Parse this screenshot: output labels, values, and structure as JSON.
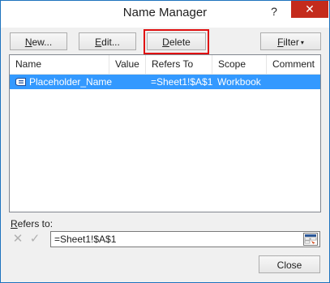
{
  "window": {
    "title": "Name Manager",
    "help": "?",
    "close_glyph": "✕"
  },
  "toolbar": {
    "new": {
      "mnemonic": "N",
      "rest": "ew..."
    },
    "edit": {
      "mnemonic": "E",
      "rest": "dit..."
    },
    "delete": {
      "mnemonic": "D",
      "rest": "elete"
    },
    "filter": {
      "mnemonic": "F",
      "rest": "ilter",
      "caret": "▾"
    }
  },
  "list": {
    "columns": [
      "Name",
      "Value",
      "Refers To",
      "Scope",
      "Comment"
    ],
    "rows": [
      {
        "name": "Placeholder_Name",
        "value": "",
        "refers_to": "=Sheet1!$A$1",
        "scope": "Workbook",
        "comment": "",
        "selected": true,
        "icon": "defined-name-icon"
      }
    ]
  },
  "refers": {
    "label_mnemonic": "R",
    "label_rest": "efers to:",
    "value": "=Sheet1!$A$1",
    "cancel_icon": "✕",
    "ok_icon": "✓"
  },
  "footer": {
    "close": "Close"
  },
  "colors": {
    "selection": "#3399ff",
    "highlight_border": "#e01010",
    "close_button": "#c42b1c"
  }
}
